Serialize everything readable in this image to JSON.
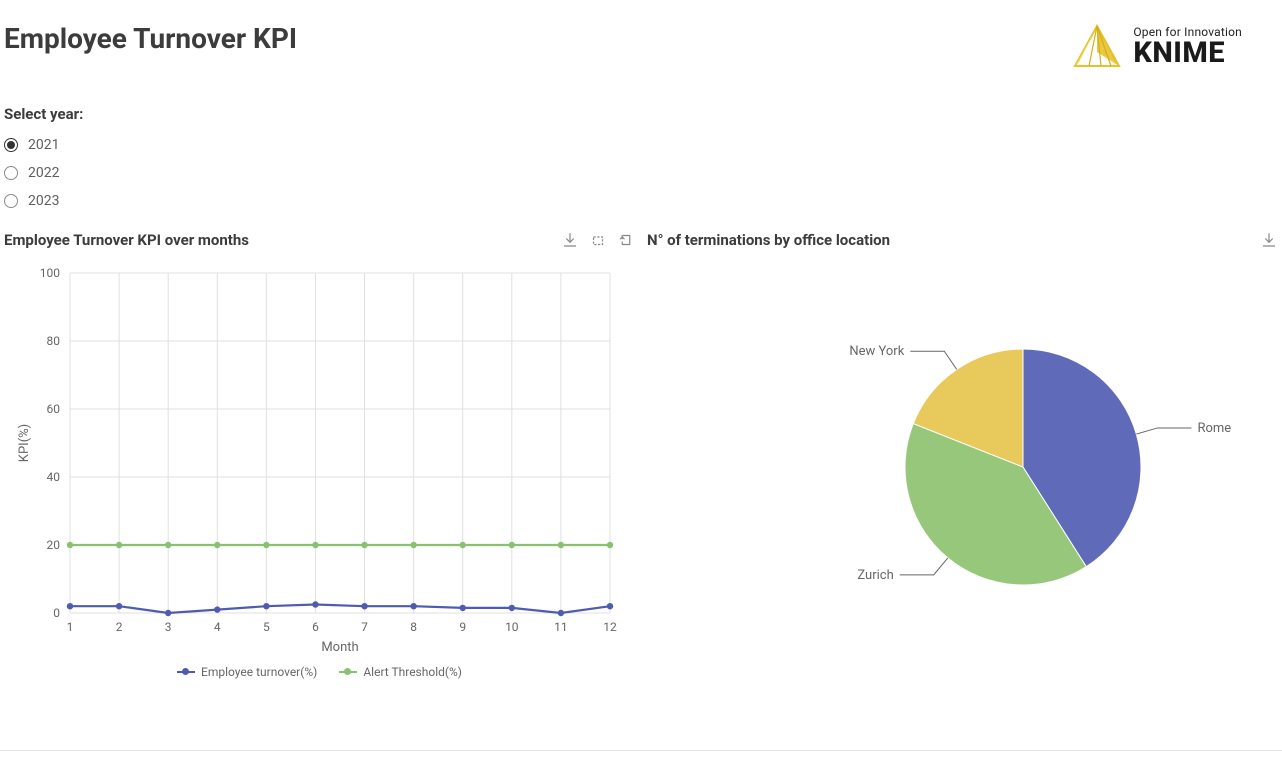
{
  "header": {
    "title": "Employee Turnover KPI",
    "logo_tagline": "Open for Innovation",
    "logo_name": "KNIME"
  },
  "year_selector": {
    "label": "Select year:",
    "options": [
      {
        "label": "2021",
        "selected": true
      },
      {
        "label": "2022",
        "selected": false
      },
      {
        "label": "2023",
        "selected": false
      }
    ]
  },
  "charts": {
    "line": {
      "title": "Employee Turnover KPI over months"
    },
    "pie": {
      "title": "N° of terminations by office location"
    }
  },
  "legend": {
    "employee": "Employee turnover(%)",
    "alert": "Alert Threshold(%)"
  },
  "axis": {
    "x": "Month",
    "y": "KPI(%)"
  },
  "chart_data": [
    {
      "type": "line",
      "title": "Employee Turnover KPI over months",
      "xlabel": "Month",
      "ylabel": "KPI(%)",
      "ylim": [
        0,
        100
      ],
      "categories": [
        1,
        2,
        3,
        4,
        5,
        6,
        7,
        8,
        9,
        10,
        11,
        12
      ],
      "series": [
        {
          "name": "Employee turnover(%)",
          "values": [
            2,
            2,
            0,
            1,
            2,
            2.5,
            2,
            2,
            1.5,
            1.5,
            0,
            2
          ],
          "color": "#4f5bb1"
        },
        {
          "name": "Alert Threshold(%)",
          "values": [
            20,
            20,
            20,
            20,
            20,
            20,
            20,
            20,
            20,
            20,
            20,
            20
          ],
          "color": "#88c170"
        }
      ]
    },
    {
      "type": "pie",
      "title": "N° of terminations by office location",
      "slices": [
        {
          "label": "Rome",
          "value": 41,
          "color": "#5f6bb9"
        },
        {
          "label": "Zurich",
          "value": 40,
          "color": "#97c77a"
        },
        {
          "label": "New York",
          "value": 19,
          "color": "#e8c95c"
        }
      ]
    }
  ]
}
